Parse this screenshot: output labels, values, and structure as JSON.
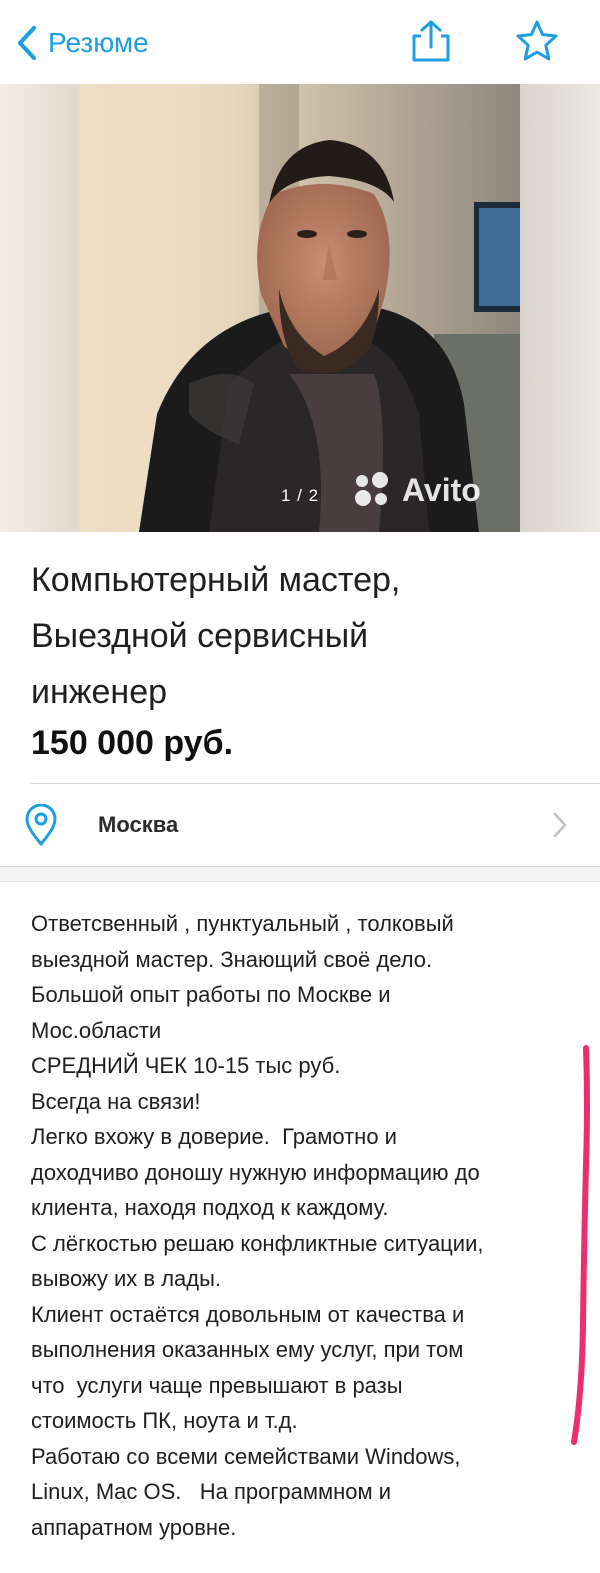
{
  "nav": {
    "back_label": "Резюме",
    "share_icon": "share-icon",
    "favorite_icon": "star-icon",
    "accent_color": "#1e9ee0"
  },
  "gallery": {
    "counter": "1 / 2",
    "watermark": "Avito"
  },
  "listing": {
    "title_lines": [
      "Компьютерный мастер,",
      "Выездной сервисный",
      "инженер"
    ],
    "price": "150 000 руб."
  },
  "location": {
    "city": "Москва",
    "icon": "map-pin-icon",
    "arrow_icon": "chevron-right-icon"
  },
  "description": {
    "lines": [
      "Ответсвенный , пунктуальный , толковый",
      "выездной мастер. Знающий своё дело.",
      "Большой опыт работы по Москве и",
      "Мос.области",
      "СРЕДНИЙ ЧЕК 10-15 тыс руб.",
      "Всегда на связи!",
      "Легко вхожу в доверие.  Грамотно и",
      "доходчиво доношу нужную информацию до",
      "клиента, находя подход к каждому.",
      "С лёгкостью решаю конфликтные ситуации,",
      "вывожу их в лады.",
      "Клиент остаётся довольным от качества и",
      "выполнения оказанных ему услуг, при том",
      "что  услуги чаще превышают в разы",
      "стоимость ПК, ноута и т.д.",
      "Работаю со всеми семействами Windows,",
      "Linux, Mac OS.   На программном и",
      "аппаратном уровне."
    ]
  },
  "annotation": {
    "mark_color": "#ec2d6e"
  }
}
